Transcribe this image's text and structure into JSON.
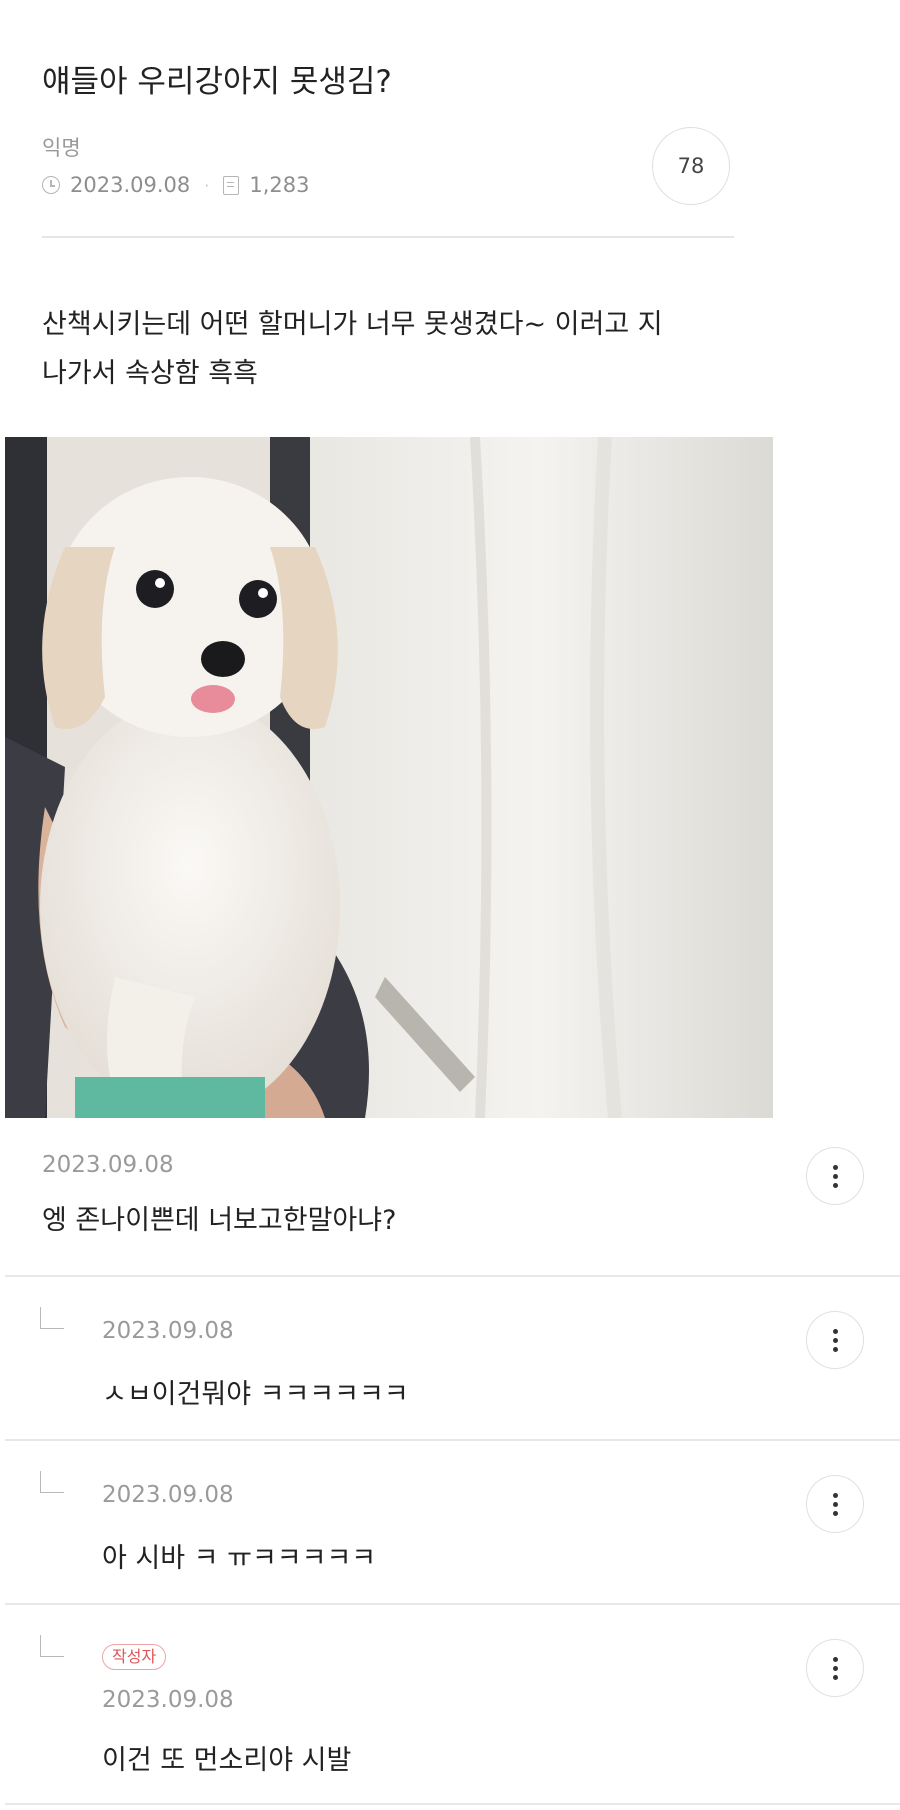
{
  "post": {
    "title": "얘들아 우리강아지 못생김?",
    "author": "익명",
    "date": "2023.09.08",
    "views": "1,283",
    "comment_count": "78",
    "body": "산책시키는데 어떤 할머니가 너무 못생겼다~ 이러고 지\n나가서 속상함 흑흑",
    "photo_icon": "dog-photo"
  },
  "comments": [
    {
      "date": "2023.09.08",
      "text": "엥 존나이쁜데 너보고한말아냐?",
      "is_reply": false
    },
    {
      "date": "2023.09.08",
      "text": "ㅅㅂ이건뭐야 ㅋㅋㅋㅋㅋㅋ",
      "is_reply": true
    },
    {
      "date": "2023.09.08",
      "text": "아 시바 ㅋ ㅠㅋㅋㅋㅋㅋ",
      "is_reply": true
    },
    {
      "date": "2023.09.08",
      "text": "이건 또 먼소리야 시발",
      "is_reply": true,
      "badge": "작성자"
    }
  ],
  "colors": {
    "badge": "#e0565b",
    "meta_text": "#8e8e8e",
    "divider": "#e6e6e6"
  }
}
